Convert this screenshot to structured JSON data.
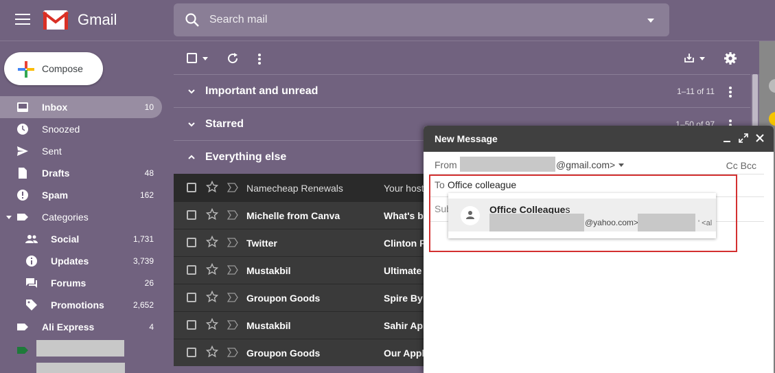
{
  "app": {
    "name": "Gmail"
  },
  "search": {
    "placeholder": "Search mail"
  },
  "compose_button": {
    "label": "Compose"
  },
  "sidebar": {
    "items": [
      {
        "label": "Inbox",
        "count": "10",
        "icon": "inbox-icon"
      },
      {
        "label": "Snoozed",
        "count": "",
        "icon": "clock-icon"
      },
      {
        "label": "Sent",
        "count": "",
        "icon": "send-icon"
      },
      {
        "label": "Drafts",
        "count": "48",
        "icon": "draft-icon"
      },
      {
        "label": "Spam",
        "count": "162",
        "icon": "spam-icon"
      },
      {
        "label": "Categories",
        "count": "",
        "icon": "label-icon"
      },
      {
        "label": "Social",
        "count": "1,731",
        "icon": "people-icon"
      },
      {
        "label": "Updates",
        "count": "3,739",
        "icon": "info-icon"
      },
      {
        "label": "Forums",
        "count": "26",
        "icon": "forum-icon"
      },
      {
        "label": "Promotions",
        "count": "2,652",
        "icon": "tag-icon"
      },
      {
        "label": "Ali Express",
        "count": "4",
        "icon": "label-icon"
      }
    ]
  },
  "sections": [
    {
      "title": "Important and unread",
      "range": "1–11 of 11"
    },
    {
      "title": "Starred",
      "range": "1–50 of 97"
    },
    {
      "title": "Everything else",
      "range": ""
    }
  ],
  "emails": [
    {
      "sender": "Namecheap Renewals",
      "subject": "Your host"
    },
    {
      "sender": "Michelle from Canva",
      "subject": "What's be"
    },
    {
      "sender": "Twitter",
      "subject": "Clinton F"
    },
    {
      "sender": "Mustakbil",
      "subject": "Ultimate"
    },
    {
      "sender": "Groupon Goods",
      "subject": "Spire By"
    },
    {
      "sender": "Mustakbil",
      "subject": "Sahir App"
    },
    {
      "sender": "Groupon Goods",
      "subject": "Our Apple"
    }
  ],
  "compose_window": {
    "title": "New Message",
    "from_label": "From",
    "from_email": "@gmail.com>",
    "cc_bcc": "Cc Bcc",
    "to_label": "To",
    "to_value": "Office colleague",
    "subject_label": "Sub",
    "suggestion": {
      "name_bold": "Office Colleague",
      "name_rest": "s",
      "email": "@yahoo.com>",
      "tail": "' <al"
    }
  },
  "colors": {
    "accent_red": "#d32f2f",
    "background": "#71627f"
  }
}
